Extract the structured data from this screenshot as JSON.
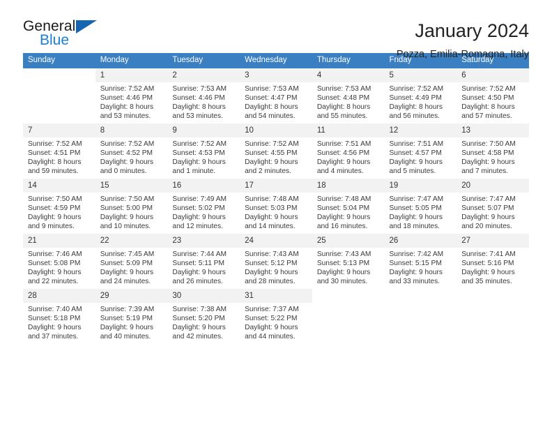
{
  "brand": {
    "name_part1": "General",
    "name_part2": "Blue",
    "triangle_color": "#1566b0",
    "blue_color": "#1a7fd4"
  },
  "header": {
    "title": "January 2024",
    "subtitle": "Pozza, Emilia-Romagna, Italy"
  },
  "theme": {
    "header_row_bg": "#3a7fc1",
    "header_row_text": "#ffffff",
    "daynum_bg": "#f2f2f2"
  },
  "weekdays": [
    "Sunday",
    "Monday",
    "Tuesday",
    "Wednesday",
    "Thursday",
    "Friday",
    "Saturday"
  ],
  "weeks": [
    [
      {
        "day": "",
        "info": ""
      },
      {
        "day": "1",
        "info": "Sunrise: 7:52 AM\nSunset: 4:46 PM\nDaylight: 8 hours\nand 53 minutes."
      },
      {
        "day": "2",
        "info": "Sunrise: 7:53 AM\nSunset: 4:46 PM\nDaylight: 8 hours\nand 53 minutes."
      },
      {
        "day": "3",
        "info": "Sunrise: 7:53 AM\nSunset: 4:47 PM\nDaylight: 8 hours\nand 54 minutes."
      },
      {
        "day": "4",
        "info": "Sunrise: 7:53 AM\nSunset: 4:48 PM\nDaylight: 8 hours\nand 55 minutes."
      },
      {
        "day": "5",
        "info": "Sunrise: 7:52 AM\nSunset: 4:49 PM\nDaylight: 8 hours\nand 56 minutes."
      },
      {
        "day": "6",
        "info": "Sunrise: 7:52 AM\nSunset: 4:50 PM\nDaylight: 8 hours\nand 57 minutes."
      }
    ],
    [
      {
        "day": "7",
        "info": "Sunrise: 7:52 AM\nSunset: 4:51 PM\nDaylight: 8 hours\nand 59 minutes."
      },
      {
        "day": "8",
        "info": "Sunrise: 7:52 AM\nSunset: 4:52 PM\nDaylight: 9 hours\nand 0 minutes."
      },
      {
        "day": "9",
        "info": "Sunrise: 7:52 AM\nSunset: 4:53 PM\nDaylight: 9 hours\nand 1 minute."
      },
      {
        "day": "10",
        "info": "Sunrise: 7:52 AM\nSunset: 4:55 PM\nDaylight: 9 hours\nand 2 minutes."
      },
      {
        "day": "11",
        "info": "Sunrise: 7:51 AM\nSunset: 4:56 PM\nDaylight: 9 hours\nand 4 minutes."
      },
      {
        "day": "12",
        "info": "Sunrise: 7:51 AM\nSunset: 4:57 PM\nDaylight: 9 hours\nand 5 minutes."
      },
      {
        "day": "13",
        "info": "Sunrise: 7:50 AM\nSunset: 4:58 PM\nDaylight: 9 hours\nand 7 minutes."
      }
    ],
    [
      {
        "day": "14",
        "info": "Sunrise: 7:50 AM\nSunset: 4:59 PM\nDaylight: 9 hours\nand 9 minutes."
      },
      {
        "day": "15",
        "info": "Sunrise: 7:50 AM\nSunset: 5:00 PM\nDaylight: 9 hours\nand 10 minutes."
      },
      {
        "day": "16",
        "info": "Sunrise: 7:49 AM\nSunset: 5:02 PM\nDaylight: 9 hours\nand 12 minutes."
      },
      {
        "day": "17",
        "info": "Sunrise: 7:48 AM\nSunset: 5:03 PM\nDaylight: 9 hours\nand 14 minutes."
      },
      {
        "day": "18",
        "info": "Sunrise: 7:48 AM\nSunset: 5:04 PM\nDaylight: 9 hours\nand 16 minutes."
      },
      {
        "day": "19",
        "info": "Sunrise: 7:47 AM\nSunset: 5:05 PM\nDaylight: 9 hours\nand 18 minutes."
      },
      {
        "day": "20",
        "info": "Sunrise: 7:47 AM\nSunset: 5:07 PM\nDaylight: 9 hours\nand 20 minutes."
      }
    ],
    [
      {
        "day": "21",
        "info": "Sunrise: 7:46 AM\nSunset: 5:08 PM\nDaylight: 9 hours\nand 22 minutes."
      },
      {
        "day": "22",
        "info": "Sunrise: 7:45 AM\nSunset: 5:09 PM\nDaylight: 9 hours\nand 24 minutes."
      },
      {
        "day": "23",
        "info": "Sunrise: 7:44 AM\nSunset: 5:11 PM\nDaylight: 9 hours\nand 26 minutes."
      },
      {
        "day": "24",
        "info": "Sunrise: 7:43 AM\nSunset: 5:12 PM\nDaylight: 9 hours\nand 28 minutes."
      },
      {
        "day": "25",
        "info": "Sunrise: 7:43 AM\nSunset: 5:13 PM\nDaylight: 9 hours\nand 30 minutes."
      },
      {
        "day": "26",
        "info": "Sunrise: 7:42 AM\nSunset: 5:15 PM\nDaylight: 9 hours\nand 33 minutes."
      },
      {
        "day": "27",
        "info": "Sunrise: 7:41 AM\nSunset: 5:16 PM\nDaylight: 9 hours\nand 35 minutes."
      }
    ],
    [
      {
        "day": "28",
        "info": "Sunrise: 7:40 AM\nSunset: 5:18 PM\nDaylight: 9 hours\nand 37 minutes."
      },
      {
        "day": "29",
        "info": "Sunrise: 7:39 AM\nSunset: 5:19 PM\nDaylight: 9 hours\nand 40 minutes."
      },
      {
        "day": "30",
        "info": "Sunrise: 7:38 AM\nSunset: 5:20 PM\nDaylight: 9 hours\nand 42 minutes."
      },
      {
        "day": "31",
        "info": "Sunrise: 7:37 AM\nSunset: 5:22 PM\nDaylight: 9 hours\nand 44 minutes."
      },
      {
        "day": "",
        "info": ""
      },
      {
        "day": "",
        "info": ""
      },
      {
        "day": "",
        "info": ""
      }
    ]
  ]
}
